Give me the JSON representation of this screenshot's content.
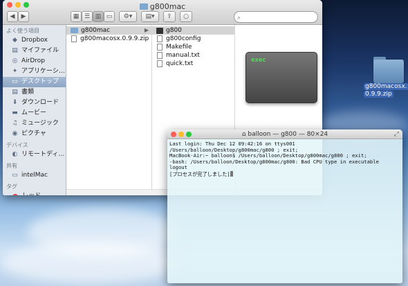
{
  "finder": {
    "title": "g800mac",
    "search_placeholder": "",
    "sidebar": {
      "favorites_header": "よく使う項目",
      "favorites": [
        {
          "label": "Dropbox",
          "icon": "box-icon"
        },
        {
          "label": "マイファイル",
          "icon": "files-icon"
        },
        {
          "label": "AirDrop",
          "icon": "airdrop-icon"
        },
        {
          "label": "アプリケーシ…",
          "icon": "apps-icon"
        },
        {
          "label": "デスクトップ",
          "icon": "desktop-icon"
        },
        {
          "label": "書類",
          "icon": "documents-icon"
        },
        {
          "label": "ダウンロード",
          "icon": "download-icon"
        },
        {
          "label": "ムービー",
          "icon": "movie-icon"
        },
        {
          "label": "ミュージック",
          "icon": "music-icon"
        },
        {
          "label": "ピクチャ",
          "icon": "camera-icon"
        }
      ],
      "devices_header": "デバイス",
      "devices": [
        {
          "label": "リモートディ…",
          "icon": "disc-icon"
        }
      ],
      "shared_header": "共有",
      "shared": [
        {
          "label": "intelMac",
          "icon": "computer-icon"
        }
      ],
      "tags_header": "タグ",
      "tags": [
        {
          "label": "レッド",
          "color": "#e2463e"
        }
      ]
    },
    "column1": [
      {
        "label": "g800mac",
        "type": "folder"
      },
      {
        "label": "g800macosx.0.9.9.zip",
        "type": "zip"
      }
    ],
    "column2": [
      {
        "label": "g800",
        "type": "exec"
      },
      {
        "label": "g800config",
        "type": "doc"
      },
      {
        "label": "Makefile",
        "type": "doc"
      },
      {
        "label": "manual.txt",
        "type": "doc"
      },
      {
        "label": "quick.txt",
        "type": "doc"
      }
    ],
    "preview_label": "exec"
  },
  "desktop_icon": {
    "label_line1": "g800macosx.",
    "label_line2": "0.9.9.zip"
  },
  "terminal": {
    "title": "balloon — g800 — 80×24",
    "lines": [
      "Last login: Thu Dec 12 09:42:16 on ttys001",
      "/Users/balloon/Desktop/g800mac/g800 ; exit;",
      "MacBook-Air:~ balloon$ /Users/balloon/Desktop/g800mac/g800 ; exit;",
      "-bash: /Users/balloon/Desktop/g800mac/g800: Bad CPU type in executable",
      "logout",
      "",
      "[プロセスが完了しました]"
    ]
  },
  "colors": {
    "close": "#ff5f57",
    "minimize": "#febc2e",
    "zoom": "#28c840",
    "selection": "#8da5c4"
  }
}
